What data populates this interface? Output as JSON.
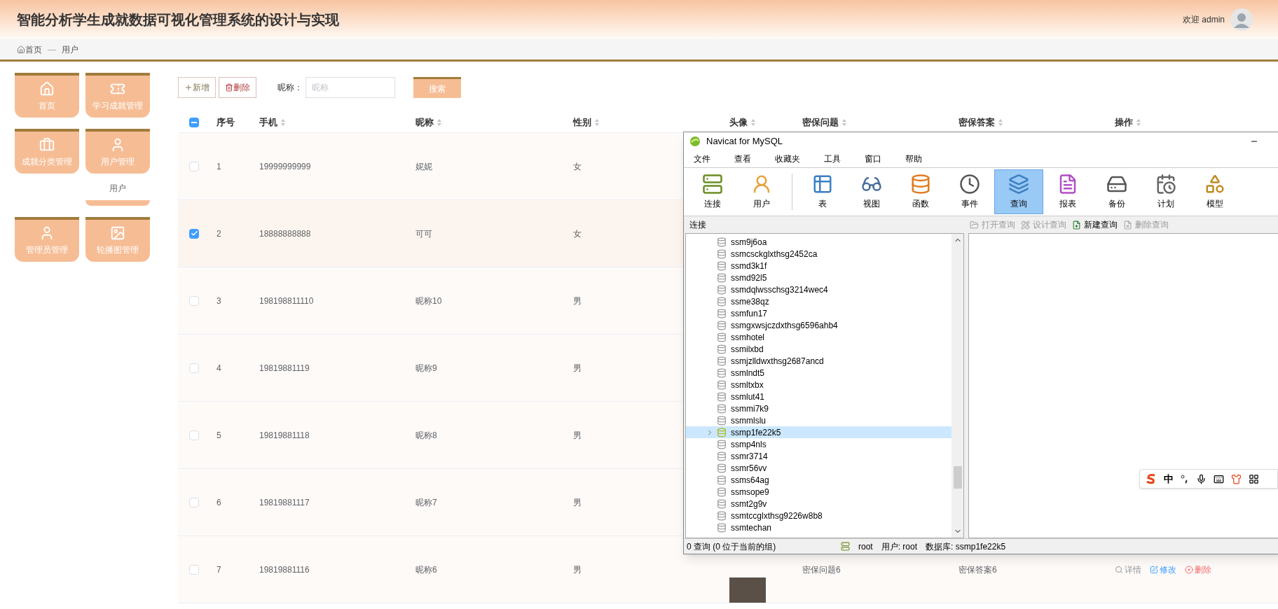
{
  "header": {
    "title": "智能分析学生成就数据可视化管理系统的设计与实现",
    "welcome": "欢迎 admin"
  },
  "breadcrumb": [
    "首页",
    "用户"
  ],
  "breadcrumb_separator": "—",
  "sidebar": [
    {
      "label": "首页"
    },
    {
      "label": "学习成就管理"
    },
    {
      "label": "成就分类管理"
    },
    {
      "label": "用户管理",
      "children": [
        {
          "label": "用户"
        }
      ]
    },
    {
      "label": "管理员管理"
    },
    {
      "label": "轮播图管理"
    }
  ],
  "toolbar": {
    "add": "新增",
    "delete": "删除",
    "search_label": "昵称：",
    "search_placeholder": "昵称",
    "search_button": "搜索"
  },
  "table": {
    "header_indeterminate": true,
    "columns": [
      {
        "label": "序号",
        "sortable": false
      },
      {
        "label": "手机",
        "sortable": true
      },
      {
        "label": "昵称",
        "sortable": true
      },
      {
        "label": "性别",
        "sortable": true
      },
      {
        "label": "头像",
        "sortable": true
      },
      {
        "label": "密保问题",
        "sortable": true
      },
      {
        "label": "密保答案",
        "sortable": true
      },
      {
        "label": "操作",
        "sortable": true
      }
    ],
    "rows": [
      {
        "no": "1",
        "phone": "19999999999",
        "nickname": "妮妮",
        "gender": "女",
        "selected": false
      },
      {
        "no": "2",
        "phone": "18888888888",
        "nickname": "可可",
        "gender": "女",
        "selected": true
      },
      {
        "no": "3",
        "phone": "198198811110",
        "nickname": "昵称10",
        "gender": "男",
        "selected": false
      },
      {
        "no": "4",
        "phone": "19819881119",
        "nickname": "昵称9",
        "gender": "男",
        "selected": false
      },
      {
        "no": "5",
        "phone": "19819881118",
        "nickname": "昵称8",
        "gender": "男",
        "selected": false
      },
      {
        "no": "6",
        "phone": "19819881117",
        "nickname": "昵称7",
        "gender": "男",
        "selected": false
      },
      {
        "no": "7",
        "phone": "19819881116",
        "nickname": "昵称6",
        "gender": "男",
        "selected": false,
        "photo": true,
        "question": "密保问题6",
        "answer": "密保答案6",
        "actions": [
          "详情",
          "修改",
          "删除"
        ]
      }
    ]
  },
  "navicat": {
    "title": "Navicat for MySQL",
    "menu": [
      "文件",
      "查看",
      "收藏夹",
      "工具",
      "窗口",
      "帮助"
    ],
    "tools": [
      {
        "label": "连接",
        "selected": false
      },
      {
        "label": "用户",
        "selected": false
      },
      {
        "label": "表",
        "selected": false
      },
      {
        "label": "视图",
        "selected": false
      },
      {
        "label": "函数",
        "selected": false
      },
      {
        "label": "事件",
        "selected": false
      },
      {
        "label": "查询",
        "selected": true
      },
      {
        "label": "报表",
        "selected": false
      },
      {
        "label": "备份",
        "selected": false
      },
      {
        "label": "计划",
        "selected": false
      },
      {
        "label": "模型",
        "selected": false
      }
    ],
    "connection_label": "连接",
    "query_actions": [
      {
        "label": "打开查询",
        "disabled": true
      },
      {
        "label": "设计查询",
        "disabled": true
      },
      {
        "label": "新建查询",
        "disabled": false
      },
      {
        "label": "删除查询",
        "disabled": true
      }
    ],
    "databases": [
      {
        "name": "ssm9j6oa",
        "selected": false
      },
      {
        "name": "ssmcsckglxthsg2452ca",
        "selected": false
      },
      {
        "name": "ssmd3k1f",
        "selected": false
      },
      {
        "name": "ssmd92l5",
        "selected": false
      },
      {
        "name": "ssmdqlwsschsg3214wec4",
        "selected": false
      },
      {
        "name": "ssme38qz",
        "selected": false
      },
      {
        "name": "ssmfun17",
        "selected": false
      },
      {
        "name": "ssmgxwsjczdxthsg6596ahb4",
        "selected": false
      },
      {
        "name": "ssmhotel",
        "selected": false
      },
      {
        "name": "ssmilxbd",
        "selected": false
      },
      {
        "name": "ssmjzlldwxthsg2687ancd",
        "selected": false
      },
      {
        "name": "ssmlndt5",
        "selected": false
      },
      {
        "name": "ssmltxbx",
        "selected": false
      },
      {
        "name": "ssmlut41",
        "selected": false
      },
      {
        "name": "ssmmi7k9",
        "selected": false
      },
      {
        "name": "ssmmlslu",
        "selected": false
      },
      {
        "name": "ssmp1fe22k5",
        "selected": true
      },
      {
        "name": "ssmp4nls",
        "selected": false
      },
      {
        "name": "ssmr3714",
        "selected": false
      },
      {
        "name": "ssmr56vv",
        "selected": false
      },
      {
        "name": "ssms64ag",
        "selected": false
      },
      {
        "name": "ssmsope9",
        "selected": false
      },
      {
        "name": "ssmt2g9v",
        "selected": false
      },
      {
        "name": "ssmtccglxthsg9226w8b8",
        "selected": false
      },
      {
        "name": "ssmtechan",
        "selected": false
      }
    ],
    "status": {
      "queries": "0 查询 (0 位于当前的组)",
      "server": "root",
      "user": "用户: root",
      "database": "数据库: ssmp1fe22k5"
    }
  },
  "ime": {
    "mode": "中"
  }
}
